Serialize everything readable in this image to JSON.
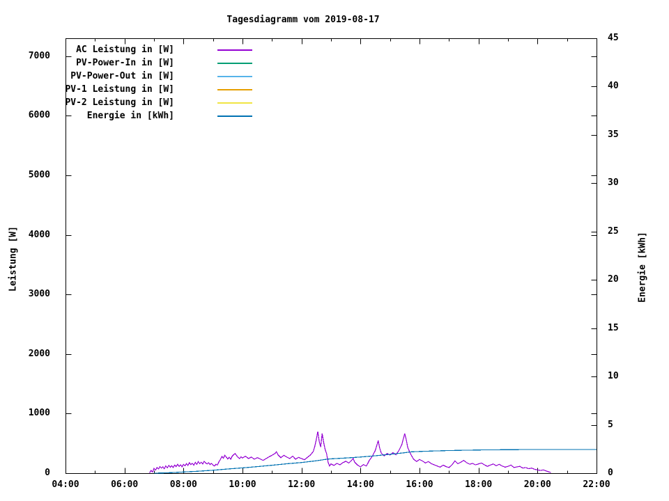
{
  "title": "Tagesdiagramm vom 2019-08-17",
  "axes": {
    "x": {
      "range": [
        4,
        22
      ],
      "major_ticks": [
        {
          "v": 4,
          "label": "04:00"
        },
        {
          "v": 6,
          "label": "06:00"
        },
        {
          "v": 8,
          "label": "08:00"
        },
        {
          "v": 10,
          "label": "10:00"
        },
        {
          "v": 12,
          "label": "12:00"
        },
        {
          "v": 14,
          "label": "14:00"
        },
        {
          "v": 16,
          "label": "16:00"
        },
        {
          "v": 18,
          "label": "18:00"
        },
        {
          "v": 20,
          "label": "20:00"
        },
        {
          "v": 22,
          "label": "22:00"
        }
      ],
      "minor_ticks": [
        5,
        7,
        9,
        11,
        13,
        15,
        17,
        19,
        21
      ]
    },
    "y_left": {
      "label": "Leistung [W]",
      "range": [
        0,
        7300
      ],
      "ticks": [
        {
          "v": 0,
          "label": "0"
        },
        {
          "v": 1000,
          "label": "1000"
        },
        {
          "v": 2000,
          "label": "2000"
        },
        {
          "v": 3000,
          "label": "3000"
        },
        {
          "v": 4000,
          "label": "4000"
        },
        {
          "v": 5000,
          "label": "5000"
        },
        {
          "v": 6000,
          "label": "6000"
        },
        {
          "v": 7000,
          "label": "7000"
        }
      ]
    },
    "y_right": {
      "label": "Energie [kWh]",
      "range": [
        0,
        45
      ],
      "ticks": [
        {
          "v": 0,
          "label": "0"
        },
        {
          "v": 5,
          "label": "5"
        },
        {
          "v": 10,
          "label": "10"
        },
        {
          "v": 15,
          "label": "15"
        },
        {
          "v": 20,
          "label": "20"
        },
        {
          "v": 25,
          "label": "25"
        },
        {
          "v": 30,
          "label": "30"
        },
        {
          "v": 35,
          "label": "35"
        },
        {
          "v": 40,
          "label": "40"
        },
        {
          "v": 45,
          "label": "45"
        }
      ]
    }
  },
  "legend": [
    {
      "label": "AC Leistung in [W]",
      "color": "#9400D3"
    },
    {
      "label": "PV-Power-In in [W]",
      "color": "#009E73"
    },
    {
      "label": "PV-Power-Out in [W]",
      "color": "#56B4E9"
    },
    {
      "label": "PV-1 Leistung in [W]",
      "color": "#E69F00"
    },
    {
      "label": "PV-2 Leistung in [W]",
      "color": "#F0E442"
    },
    {
      "label": "Energie in [kWh]",
      "color": "#0072B2"
    }
  ],
  "chart_data": {
    "type": "line",
    "title": "Tagesdiagramm vom 2019-08-17",
    "xlabel": "",
    "x_unit": "time of day (hours)",
    "x_range": [
      4,
      22
    ],
    "y_left_label": "Leistung [W]",
    "y_left_range": [
      0,
      7300
    ],
    "y_right_label": "Energie [kWh]",
    "y_right_range": [
      0,
      45
    ],
    "grid": false,
    "legend_position": "top-left",
    "series": [
      {
        "name": "AC Leistung in [W]",
        "color": "#9400D3",
        "axis": "left",
        "points": [
          [
            6.85,
            5
          ],
          [
            6.9,
            45
          ],
          [
            6.95,
            20
          ],
          [
            7.0,
            80
          ],
          [
            7.05,
            50
          ],
          [
            7.1,
            95
          ],
          [
            7.15,
            70
          ],
          [
            7.2,
            110
          ],
          [
            7.25,
            85
          ],
          [
            7.3,
            105
          ],
          [
            7.35,
            75
          ],
          [
            7.4,
            120
          ],
          [
            7.45,
            90
          ],
          [
            7.5,
            130
          ],
          [
            7.55,
            100
          ],
          [
            7.6,
            125
          ],
          [
            7.65,
            95
          ],
          [
            7.7,
            135
          ],
          [
            7.75,
            110
          ],
          [
            7.8,
            150
          ],
          [
            7.85,
            115
          ],
          [
            7.9,
            140
          ],
          [
            7.95,
            105
          ],
          [
            8.0,
            150
          ],
          [
            8.05,
            125
          ],
          [
            8.1,
            160
          ],
          [
            8.15,
            130
          ],
          [
            8.2,
            175
          ],
          [
            8.25,
            145
          ],
          [
            8.3,
            165
          ],
          [
            8.35,
            135
          ],
          [
            8.4,
            180
          ],
          [
            8.45,
            150
          ],
          [
            8.5,
            195
          ],
          [
            8.55,
            160
          ],
          [
            8.6,
            185
          ],
          [
            8.65,
            155
          ],
          [
            8.7,
            200
          ],
          [
            8.75,
            170
          ],
          [
            8.8,
            155
          ],
          [
            8.85,
            175
          ],
          [
            8.9,
            145
          ],
          [
            8.95,
            165
          ],
          [
            9.0,
            135
          ],
          [
            9.05,
            120
          ],
          [
            9.1,
            150
          ],
          [
            9.15,
            135
          ],
          [
            9.2,
            190
          ],
          [
            9.25,
            230
          ],
          [
            9.3,
            280
          ],
          [
            9.35,
            250
          ],
          [
            9.4,
            300
          ],
          [
            9.45,
            270
          ],
          [
            9.5,
            240
          ],
          [
            9.55,
            265
          ],
          [
            9.6,
            235
          ],
          [
            9.65,
            285
          ],
          [
            9.7,
            310
          ],
          [
            9.75,
            330
          ],
          [
            9.8,
            295
          ],
          [
            9.85,
            265
          ],
          [
            9.9,
            245
          ],
          [
            9.95,
            275
          ],
          [
            10.0,
            255
          ],
          [
            10.1,
            285
          ],
          [
            10.2,
            245
          ],
          [
            10.3,
            270
          ],
          [
            10.4,
            235
          ],
          [
            10.5,
            260
          ],
          [
            10.6,
            240
          ],
          [
            10.7,
            215
          ],
          [
            10.8,
            245
          ],
          [
            10.9,
            275
          ],
          [
            11.0,
            300
          ],
          [
            11.1,
            330
          ],
          [
            11.15,
            360
          ],
          [
            11.2,
            310
          ],
          [
            11.3,
            260
          ],
          [
            11.4,
            300
          ],
          [
            11.5,
            270
          ],
          [
            11.6,
            245
          ],
          [
            11.7,
            285
          ],
          [
            11.8,
            235
          ],
          [
            11.9,
            265
          ],
          [
            12.0,
            245
          ],
          [
            12.1,
            225
          ],
          [
            12.2,
            265
          ],
          [
            12.3,
            305
          ],
          [
            12.4,
            365
          ],
          [
            12.45,
            450
          ],
          [
            12.5,
            560
          ],
          [
            12.55,
            700
          ],
          [
            12.6,
            530
          ],
          [
            12.65,
            440
          ],
          [
            12.7,
            665
          ],
          [
            12.75,
            520
          ],
          [
            12.8,
            400
          ],
          [
            12.85,
            330
          ],
          [
            12.9,
            185
          ],
          [
            12.95,
            120
          ],
          [
            13.0,
            155
          ],
          [
            13.1,
            130
          ],
          [
            13.2,
            165
          ],
          [
            13.3,
            140
          ],
          [
            13.4,
            175
          ],
          [
            13.5,
            200
          ],
          [
            13.6,
            170
          ],
          [
            13.7,
            215
          ],
          [
            13.75,
            250
          ],
          [
            13.8,
            185
          ],
          [
            13.9,
            135
          ],
          [
            14.0,
            105
          ],
          [
            14.1,
            145
          ],
          [
            14.2,
            120
          ],
          [
            14.3,
            215
          ],
          [
            14.4,
            285
          ],
          [
            14.5,
            380
          ],
          [
            14.6,
            545
          ],
          [
            14.65,
            420
          ],
          [
            14.7,
            340
          ],
          [
            14.8,
            290
          ],
          [
            14.9,
            330
          ],
          [
            15.0,
            305
          ],
          [
            15.1,
            345
          ],
          [
            15.2,
            310
          ],
          [
            15.3,
            380
          ],
          [
            15.4,
            480
          ],
          [
            15.5,
            665
          ],
          [
            15.55,
            560
          ],
          [
            15.6,
            430
          ],
          [
            15.7,
            320
          ],
          [
            15.8,
            235
          ],
          [
            15.9,
            195
          ],
          [
            16.0,
            230
          ],
          [
            16.1,
            205
          ],
          [
            16.2,
            170
          ],
          [
            16.3,
            195
          ],
          [
            16.4,
            160
          ],
          [
            16.5,
            140
          ],
          [
            16.6,
            120
          ],
          [
            16.7,
            100
          ],
          [
            16.8,
            135
          ],
          [
            16.9,
            110
          ],
          [
            17.0,
            95
          ],
          [
            17.1,
            140
          ],
          [
            17.2,
            205
          ],
          [
            17.3,
            160
          ],
          [
            17.4,
            185
          ],
          [
            17.5,
            215
          ],
          [
            17.6,
            175
          ],
          [
            17.7,
            150
          ],
          [
            17.8,
            165
          ],
          [
            17.9,
            140
          ],
          [
            18.0,
            155
          ],
          [
            18.1,
            170
          ],
          [
            18.2,
            140
          ],
          [
            18.3,
            115
          ],
          [
            18.4,
            135
          ],
          [
            18.5,
            155
          ],
          [
            18.6,
            125
          ],
          [
            18.7,
            150
          ],
          [
            18.8,
            120
          ],
          [
            18.9,
            100
          ],
          [
            19.0,
            115
          ],
          [
            19.1,
            135
          ],
          [
            19.2,
            95
          ],
          [
            19.3,
            105
          ],
          [
            19.4,
            115
          ],
          [
            19.5,
            85
          ],
          [
            19.6,
            95
          ],
          [
            19.7,
            75
          ],
          [
            19.8,
            85
          ],
          [
            19.9,
            65
          ],
          [
            20.0,
            55
          ],
          [
            20.1,
            45
          ],
          [
            20.2,
            55
          ],
          [
            20.3,
            35
          ],
          [
            20.4,
            20
          ],
          [
            20.45,
            8
          ]
        ]
      },
      {
        "name": "PV-Power-In in [W]",
        "color": "#009E73",
        "axis": "left",
        "points": []
      },
      {
        "name": "PV-Power-Out in [W]",
        "color": "#56B4E9",
        "axis": "left",
        "points": []
      },
      {
        "name": "PV-1 Leistung in [W]",
        "color": "#E69F00",
        "axis": "left",
        "points": []
      },
      {
        "name": "PV-2 Leistung in [W]",
        "color": "#F0E442",
        "axis": "left",
        "points": []
      },
      {
        "name": "Energie in [kWh]",
        "color": "#0072B2",
        "axis": "right",
        "points": [
          [
            7.0,
            0
          ],
          [
            7.3,
            0.02
          ],
          [
            7.6,
            0.06
          ],
          [
            8.0,
            0.12
          ],
          [
            8.5,
            0.2
          ],
          [
            9.0,
            0.3
          ],
          [
            9.5,
            0.43
          ],
          [
            10.0,
            0.55
          ],
          [
            10.5,
            0.68
          ],
          [
            11.0,
            0.82
          ],
          [
            11.5,
            0.97
          ],
          [
            12.0,
            1.1
          ],
          [
            12.5,
            1.28
          ],
          [
            12.8,
            1.42
          ],
          [
            13.0,
            1.48
          ],
          [
            13.5,
            1.57
          ],
          [
            14.0,
            1.67
          ],
          [
            14.5,
            1.8
          ],
          [
            15.0,
            1.95
          ],
          [
            15.5,
            2.12
          ],
          [
            15.7,
            2.2
          ],
          [
            16.0,
            2.25
          ],
          [
            16.5,
            2.3
          ],
          [
            17.0,
            2.34
          ],
          [
            17.5,
            2.37
          ],
          [
            18.0,
            2.4
          ],
          [
            18.5,
            2.42
          ],
          [
            19.0,
            2.43
          ],
          [
            19.5,
            2.44
          ],
          [
            20.0,
            2.45
          ],
          [
            20.5,
            2.45
          ],
          [
            22.0,
            2.45
          ]
        ]
      }
    ]
  }
}
